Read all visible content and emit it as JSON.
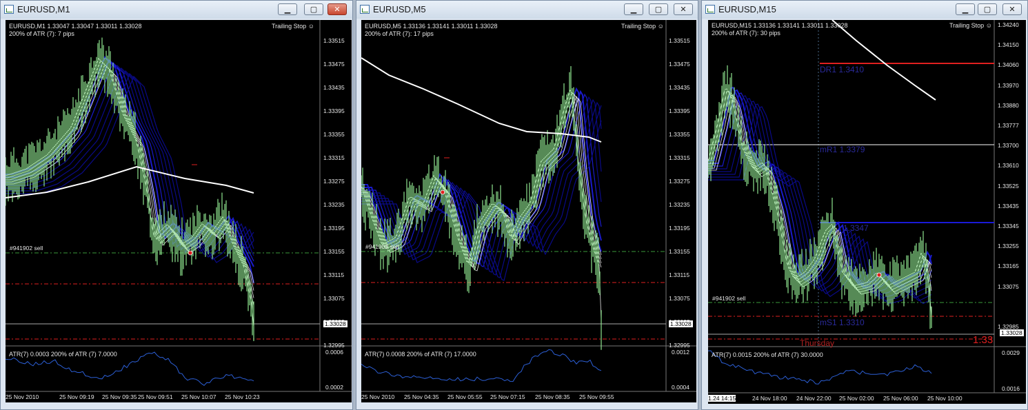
{
  "colors": {
    "bullish": "#8fe58f",
    "white": "#ffffff",
    "blue": "#1a1acc",
    "darkblue": "#0a0a88",
    "red": "#e02020",
    "sell_line": "#3a9a3a",
    "atr": "#2c5fd6",
    "grid": "#3a3a3a"
  },
  "windows": [
    {
      "title": "EURUSD,M1",
      "info_line1": "EURUSD,M1  1.33047 1.33047 1.33011 1.33028",
      "info_line2": "200% of ATR (7): 7 pips",
      "trailing_label": "Trailing Stop ☺",
      "y_labels": [
        "1.33515",
        "1.33475",
        "1.33435",
        "1.33395",
        "1.33355",
        "1.33315",
        "1.33275",
        "1.33235",
        "1.33195",
        "1.33155",
        "1.33115",
        "1.33075",
        "1.33035",
        "1.32995"
      ],
      "current_price": "1.33028",
      "order_label": "#941902 sell",
      "atr_label": "ATR(7) 0.0003  200% of ATR (7) 7.0000",
      "atr_y_labels": [
        "0.0006",
        "0.0002"
      ],
      "x_labels": [
        "25 Nov 2010",
        "25 Nov 09:19",
        "25 Nov 09:35",
        "25 Nov 09:51",
        "25 Nov 10:07",
        "25 Nov 10:23"
      ]
    },
    {
      "title": "EURUSD,M5",
      "info_line1": "EURUSD,M5  1.33136 1.33141 1.33011 1.33028",
      "info_line2": "200% of ATR (7): 17 pips",
      "trailing_label": "Trailing Stop ☺",
      "y_labels": [
        "1.33515",
        "1.33475",
        "1.33435",
        "1.33395",
        "1.33355",
        "1.33315",
        "1.33275",
        "1.33235",
        "1.33195",
        "1.33155",
        "1.33115",
        "1.33075",
        "1.33035",
        "1.32995"
      ],
      "current_price": "1.33028",
      "order_label": "#941902 sell",
      "atr_label": "ATR(7) 0.0008  200% of ATR (7) 17.0000",
      "atr_y_labels": [
        "0.0012",
        "0.0004"
      ],
      "x_labels": [
        "25 Nov 2010",
        "25 Nov 04:35",
        "25 Nov 05:55",
        "25 Nov 07:15",
        "25 Nov 08:35",
        "25 Nov 09:55"
      ]
    },
    {
      "title": "EURUSD,M15",
      "info_line1": "EURUSD,M15  1.33136 1.33141 1.33011 1.33028",
      "info_line2": "200% of ATR (7): 30 pips",
      "trailing_label": "Trailing Stop ☺",
      "y_labels": [
        "1.34240",
        "1.34150",
        "1.34060",
        "1.33970",
        "1.33880",
        "1.33777",
        "1.33700",
        "1.33610",
        "1.33525",
        "1.33435",
        "1.33345",
        "1.33255",
        "1.33165",
        "1.33075",
        "1.33028",
        "1.32985"
      ],
      "current_price": "1.33028",
      "order_label": "#941902 sell",
      "pivot_labels": [
        "DR1  1.3410",
        "mR1  1.3379",
        "1.3347",
        "mS1  1.3310",
        "Thursday"
      ],
      "big_price": "1.33",
      "atr_label": "ATR(7) 0.0015  200% of ATR (7) 30.0000",
      "atr_y_labels": [
        "0.0029",
        "0.0016"
      ],
      "x_labels": [
        "1.24 14:15",
        "24 Nov 18:00",
        "24 Nov 22:00",
        "25 Nov 02:00",
        "25 Nov 06:00",
        "25 Nov 10:00"
      ]
    }
  ]
}
